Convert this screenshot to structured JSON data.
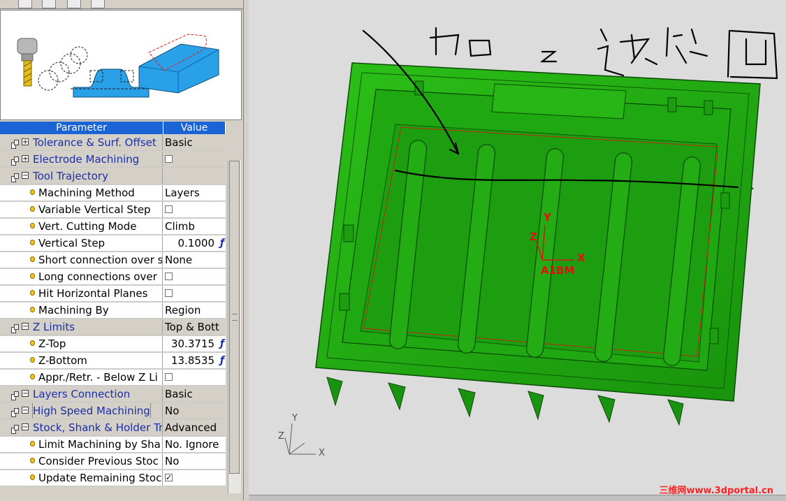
{
  "columns": {
    "parameter": "Parameter",
    "value": "Value"
  },
  "rows": [
    {
      "kind": "group",
      "expander": "+",
      "name": "Tolerance & Surf. Offset",
      "value": "Basic"
    },
    {
      "kind": "group",
      "expander": "+",
      "name": "Electrode Machining",
      "checkbox": false
    },
    {
      "kind": "group",
      "expander": "−",
      "name": "Tool Trajectory",
      "value": ""
    },
    {
      "kind": "item",
      "name": "Machining Method",
      "value": "Layers"
    },
    {
      "kind": "item",
      "name": "Variable Vertical Step",
      "checkbox": false
    },
    {
      "kind": "item",
      "name": "Vert. Cutting Mode",
      "value": "Climb"
    },
    {
      "kind": "item",
      "name": "Vertical Step",
      "value": "0.1000",
      "numeric": true,
      "formula": "ƒ"
    },
    {
      "kind": "item",
      "name": "Short connection over s",
      "value": "None"
    },
    {
      "kind": "item",
      "name": "Long connections over",
      "checkbox": false
    },
    {
      "kind": "item",
      "name": "Hit Horizontal Planes",
      "checkbox": false
    },
    {
      "kind": "item",
      "name": "Machining By",
      "value": "Region"
    },
    {
      "kind": "group",
      "expander": "−",
      "name": "Z Limits",
      "value": "Top & Bott"
    },
    {
      "kind": "item",
      "name": "Z-Top",
      "value": "30.3715",
      "numeric": true,
      "formula": "ƒ"
    },
    {
      "kind": "item",
      "name": "Z-Bottom",
      "value": "13.8535",
      "numeric": true,
      "formula": "ƒ"
    },
    {
      "kind": "item",
      "name": "Appr./Retr. - Below Z Li",
      "checkbox": false
    },
    {
      "kind": "group",
      "expander": "−",
      "name": "Layers Connection",
      "value": "Basic"
    },
    {
      "kind": "group",
      "expander": "−",
      "name": "High Speed Machining",
      "value": "No",
      "focused": true
    },
    {
      "kind": "group",
      "expander": "−",
      "name": "Stock, Shank & Holder Tr",
      "value": "Advanced"
    },
    {
      "kind": "item",
      "name": "Limit Machining by Sha",
      "value": "No. Ignore"
    },
    {
      "kind": "item",
      "name": "Consider Previous Stoc",
      "value": "No"
    },
    {
      "kind": "item",
      "name": "Update Remaining Stoc",
      "checkbox": true
    }
  ],
  "viewport": {
    "handwriting": "加 z 这些凹",
    "ucs_y": "Y",
    "ucs_z": "Z",
    "ucs_x": "X",
    "ucs_name": "A1BM",
    "triad_y": "Y",
    "triad_z": "Z",
    "triad_x": "X",
    "watermark": "三维网www.3dportal.cn"
  },
  "colors": {
    "header": "#1a64d6",
    "part": "#22a812",
    "ucs": "#e01010",
    "group_text": "#1a2fa8"
  },
  "icons": [
    "tool-illustration",
    "property-group-icon",
    "parameter-bulb-icon",
    "formula-icon"
  ]
}
